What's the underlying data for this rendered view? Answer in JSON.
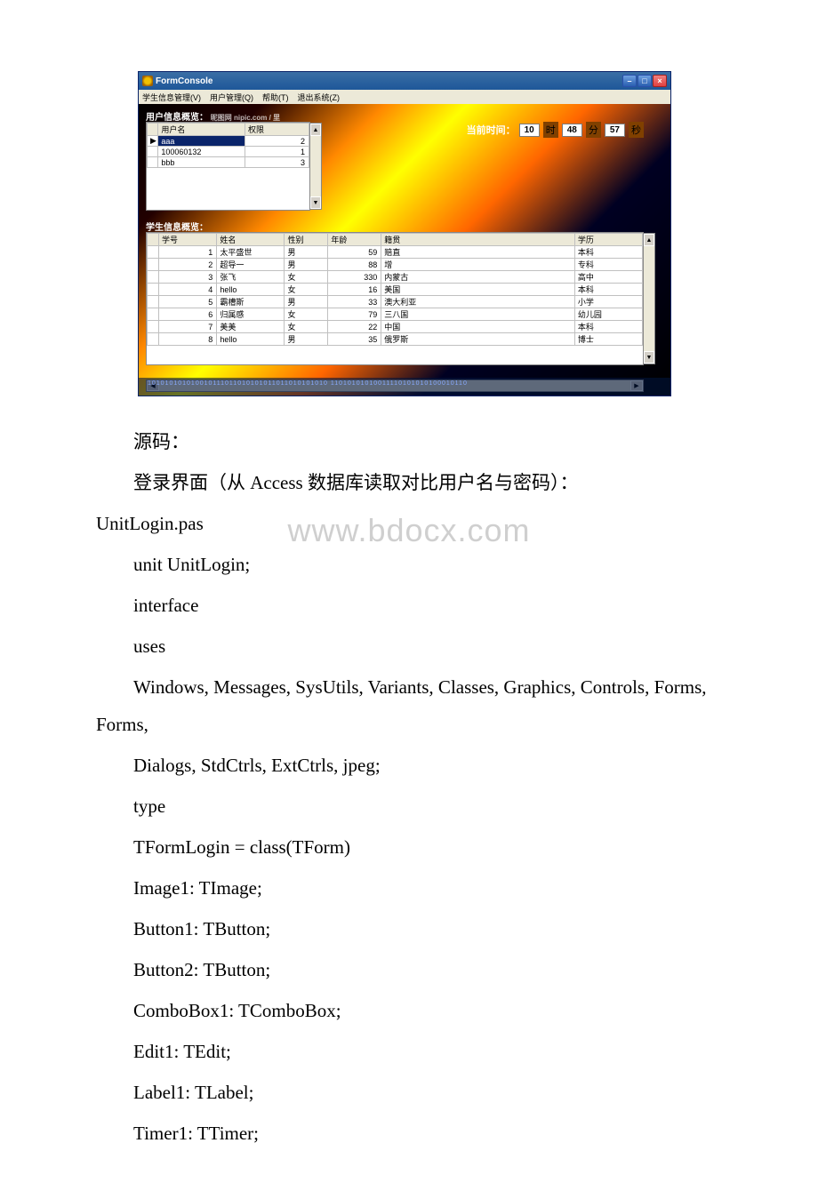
{
  "screenshot": {
    "title": "FormConsole",
    "menu": [
      "学生信息管理(V)",
      "用户管理(Q)",
      "帮助(T)",
      "退出系统(Z)"
    ],
    "brand": "昵图网 nipic.com / 里",
    "sections": {
      "users": "用户信息概览：",
      "students": "学生信息概览："
    },
    "time": {
      "label": "当前时间：",
      "h": "10",
      "h_unit": "时",
      "m": "48",
      "m_unit": "分",
      "s": "57",
      "s_unit": "秒"
    },
    "user_grid": {
      "headers": [
        "",
        "用户名",
        "权限"
      ],
      "rows": [
        {
          "ind": "▶",
          "name": "aaa",
          "perm": "2",
          "sel": true
        },
        {
          "ind": "",
          "name": "100060132",
          "perm": "1"
        },
        {
          "ind": "",
          "name": "bbb",
          "perm": "3"
        }
      ]
    },
    "student_grid": {
      "headers": [
        "",
        "学号",
        "姓名",
        "性别",
        "年龄",
        "籍贯",
        "学历"
      ],
      "rows": [
        {
          "id": "1",
          "name": "太平盛世",
          "sex": "男",
          "age": "59",
          "jg": "赔直",
          "edu": "本科"
        },
        {
          "id": "2",
          "name": "超导一",
          "sex": "男",
          "age": "88",
          "jg": "增",
          "edu": "专科"
        },
        {
          "id": "3",
          "name": "张飞",
          "sex": "女",
          "age": "330",
          "jg": "内蒙古",
          "edu": "高中"
        },
        {
          "id": "4",
          "name": "hello",
          "sex": "女",
          "age": "16",
          "jg": "美国",
          "edu": "本科"
        },
        {
          "id": "5",
          "name": "霸槽斯",
          "sex": "男",
          "age": "33",
          "jg": "澳大利亚",
          "edu": "小学"
        },
        {
          "id": "6",
          "name": "归属感",
          "sex": "女",
          "age": "79",
          "jg": "三八国",
          "edu": "幼儿园"
        },
        {
          "id": "7",
          "name": "美美",
          "sex": "女",
          "age": "22",
          "jg": "中国",
          "edu": "本科"
        },
        {
          "id": "8",
          "name": "hello",
          "sex": "男",
          "age": "35",
          "jg": "俄罗斯",
          "edu": "博士"
        }
      ]
    },
    "binary": "101010101010010111011010101011011010101010\n  11010101010011110101010100010110"
  },
  "doc": {
    "source_label": "源码：",
    "login_intro": "登录界面（从 Access 数据库读取对比用户名与密码）：",
    "login_file": "UnitLogin.pas",
    "lines": [
      "unit UnitLogin;",
      "interface",
      "uses",
      " Windows, Messages, SysUtils, Variants, Classes, Graphics, Controls, Forms,",
      " Dialogs, StdCtrls, ExtCtrls, jpeg;",
      "type",
      " TFormLogin = class(TForm)",
      " Image1: TImage;",
      " Button1: TButton;",
      " Button2: TButton;",
      " ComboBox1: TComboBox;",
      " Edit1: TEdit;",
      " Label1: TLabel;",
      " Timer1: TTimer;"
    ],
    "watermark": "www.bdocx.com"
  }
}
